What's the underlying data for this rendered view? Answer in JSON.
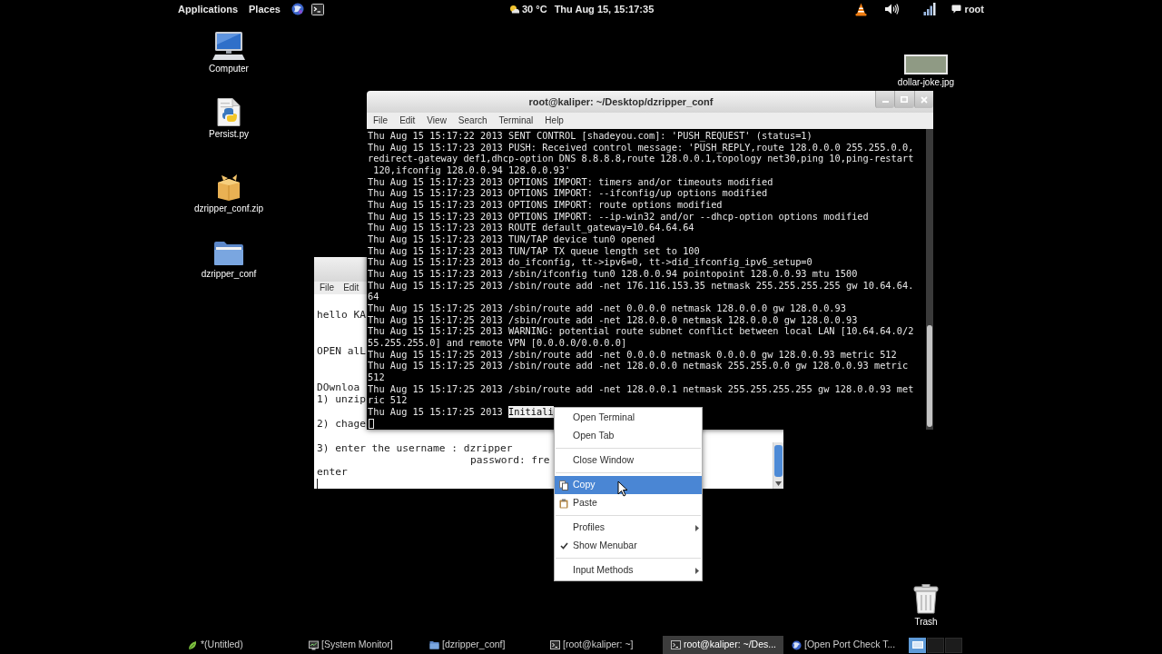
{
  "top_bar": {
    "menus": [
      "Applications",
      "Places"
    ],
    "weather": "30 °C",
    "clock": "Thu Aug 15, 15:17:35",
    "user": "root"
  },
  "desktop_icons": [
    {
      "label": "Computer",
      "kind": "computer"
    },
    {
      "label": "Persist.py",
      "kind": "script"
    },
    {
      "label": "dzripper_conf.zip",
      "kind": "archive"
    },
    {
      "label": "dzripper_conf",
      "kind": "folder"
    },
    {
      "label": "dollar-joke.jpg",
      "kind": "image"
    },
    {
      "label": "Trash",
      "kind": "trash"
    }
  ],
  "editor_window": {
    "menus": [
      "File",
      "Edit"
    ],
    "paragraphs": [
      [
        {
          "text": "hello KA",
          "kind": "line"
        }
      ],
      [
        {
          "text": "OPEN alL",
          "kind": "line"
        }
      ],
      [
        {
          "text": "DOwnloa",
          "kind": "line"
        },
        {
          "text": "1) unzip",
          "kind": "line"
        }
      ],
      [
        {
          "text": "2) chage",
          "kind": "line"
        }
      ],
      [
        {
          "text": "3) enter the username : dzripper",
          "kind": "line"
        },
        {
          "text": "password: fre",
          "kind": "indented"
        },
        {
          "text": "enter",
          "kind": "line"
        }
      ]
    ],
    "cursor": true
  },
  "terminal_window": {
    "title": "root@kaliper: ~/Desktop/dzripper_conf",
    "menus": [
      "File",
      "Edit",
      "View",
      "Search",
      "Terminal",
      "Help"
    ],
    "lines": [
      "Thu Aug 15 15:17:22 2013 SENT CONTROL [shadeyou.com]: 'PUSH_REQUEST' (status=1)",
      "Thu Aug 15 15:17:23 2013 PUSH: Received control message: 'PUSH_REPLY,route 128.0.0.0 255.255.0.0,",
      "redirect-gateway def1,dhcp-option DNS 8.8.8.8,route 128.0.0.1,topology net30,ping 10,ping-restart",
      " 120,ifconfig 128.0.0.94 128.0.0.93'",
      "Thu Aug 15 15:17:23 2013 OPTIONS IMPORT: timers and/or timeouts modified",
      "Thu Aug 15 15:17:23 2013 OPTIONS IMPORT: --ifconfig/up options modified",
      "Thu Aug 15 15:17:23 2013 OPTIONS IMPORT: route options modified",
      "Thu Aug 15 15:17:23 2013 OPTIONS IMPORT: --ip-win32 and/or --dhcp-option options modified",
      "Thu Aug 15 15:17:23 2013 ROUTE default_gateway=10.64.64.64",
      "Thu Aug 15 15:17:23 2013 TUN/TAP device tun0 opened",
      "Thu Aug 15 15:17:23 2013 TUN/TAP TX queue length set to 100",
      "Thu Aug 15 15:17:23 2013 do_ifconfig, tt->ipv6=0, tt->did_ifconfig_ipv6_setup=0",
      "Thu Aug 15 15:17:23 2013 /sbin/ifconfig tun0 128.0.0.94 pointopoint 128.0.0.93 mtu 1500",
      "Thu Aug 15 15:17:25 2013 /sbin/route add -net 176.116.153.35 netmask 255.255.255.255 gw 10.64.64.",
      "64",
      "Thu Aug 15 15:17:25 2013 /sbin/route add -net 0.0.0.0 netmask 128.0.0.0 gw 128.0.0.93",
      "Thu Aug 15 15:17:25 2013 /sbin/route add -net 128.0.0.0 netmask 128.0.0.0 gw 128.0.0.93",
      "Thu Aug 15 15:17:25 2013 WARNING: potential route subnet conflict between local LAN [10.64.64.0/2",
      "55.255.255.0] and remote VPN [0.0.0.0/0.0.0.0]",
      "Thu Aug 15 15:17:25 2013 /sbin/route add -net 0.0.0.0 netmask 0.0.0.0 gw 128.0.0.93 metric 512",
      "Thu Aug 15 15:17:25 2013 /sbin/route add -net 128.0.0.0 netmask 255.255.0.0 gw 128.0.0.93 metric",
      "512",
      "Thu Aug 15 15:17:25 2013 /sbin/route add -net 128.0.0.1 netmask 255.255.255.255 gw 128.0.0.93 met",
      "ric 512"
    ],
    "last_line": {
      "text": "Thu Aug 15 15:17:25 2013",
      "selection": "Initiali"
    },
    "cursor": true
  },
  "context_menu": {
    "groups": [
      [
        {
          "label": "Open Terminal",
          "kind": "plain",
          "selected": false
        },
        {
          "label": "Open Tab",
          "kind": "plain",
          "selected": false
        }
      ],
      [
        {
          "label": "Close Window",
          "kind": "plain",
          "selected": false
        }
      ],
      [
        {
          "label": "Copy",
          "kind": "copy",
          "selected": true
        },
        {
          "label": "Paste",
          "kind": "paste",
          "selected": false
        }
      ],
      [
        {
          "label": "Profiles",
          "kind": "submenu",
          "selected": false
        },
        {
          "label": "Show Menubar",
          "kind": "check",
          "checked": true,
          "selected": false
        }
      ],
      [
        {
          "label": "Input Methods",
          "kind": "submenu",
          "selected": false
        }
      ]
    ]
  },
  "taskbar": {
    "items": [
      {
        "label": "*(Untitled)",
        "kind": "editor",
        "selected": false
      },
      {
        "label": "[System Monitor]",
        "kind": "monitor",
        "selected": false
      },
      {
        "label": "[dzripper_conf]",
        "kind": "folder",
        "selected": false
      },
      {
        "label": "[root@kaliper: ~]",
        "kind": "terminal",
        "selected": false
      },
      {
        "label": "root@kaliper: ~/Des...",
        "kind": "terminal",
        "selected": true
      },
      {
        "label": "[Open Port Check T...",
        "kind": "browser",
        "selected": false
      }
    ],
    "workspaces": [
      {
        "selected": true
      },
      {
        "selected": false
      },
      {
        "selected": false
      }
    ]
  }
}
